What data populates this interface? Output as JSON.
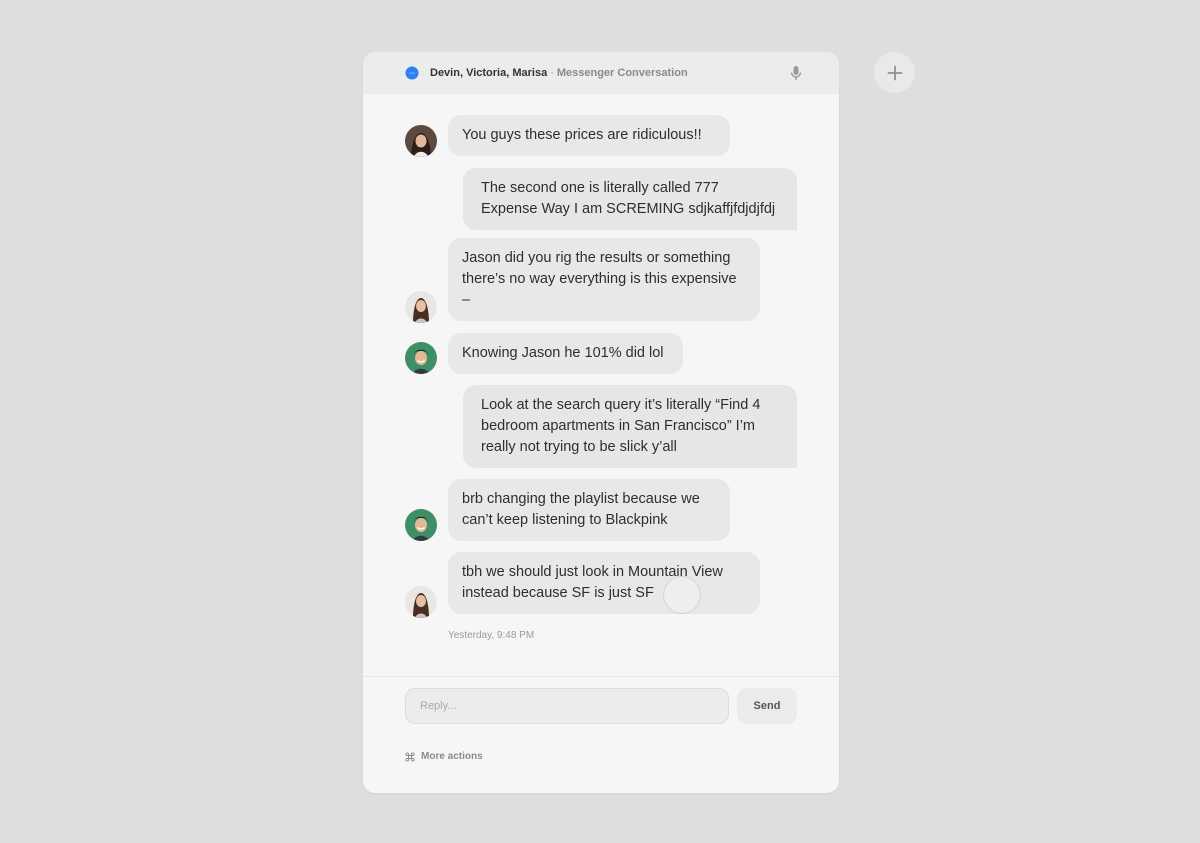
{
  "header": {
    "participants": "Devin, Victoria, Marisa",
    "separator": "·",
    "subtitle": "Messenger Conversation",
    "app_icon": "messenger-icon",
    "mic_icon": "microphone-icon"
  },
  "messages": [
    {
      "sender": "Victoria",
      "text": "You guys these prices are ridiculous!!"
    },
    {
      "sender": "me",
      "text": "The second one is literally called 777 Expense Way I am SCREMING sdjkaffjfdjdjfdj"
    },
    {
      "sender": "Marisa",
      "text": "Jason did you rig the results or something there’s no way everything is this expensive –"
    },
    {
      "sender": "Devin",
      "text": "Knowing Jason he 101% did lol"
    },
    {
      "sender": "me",
      "text": "Look at the search query it’s literally “Find 4 bedroom apartments in San Francisco” I’m really not trying to be slick y’all"
    },
    {
      "sender": "Devin",
      "text": "brb changing the playlist because we can’t keep listening to Blackpink"
    },
    {
      "sender": "Marisa",
      "text": "tbh we should just look in Mountain View instead because SF is just SF"
    }
  ],
  "timestamp": "Yesterday, 9:48 PM",
  "composer": {
    "placeholder": "Reply...",
    "value": "",
    "send_label": "Send"
  },
  "footer": {
    "more_actions_label": "More actions",
    "more_actions_icon": "command-key-icon"
  },
  "plus_icon": "plus-icon",
  "colors": {
    "background": "#dedede",
    "panel": "#f6f6f6",
    "bubble": "#e8e8e8",
    "messenger_blue": "#2d7ff9",
    "avatar_green": "#3f8f66"
  }
}
